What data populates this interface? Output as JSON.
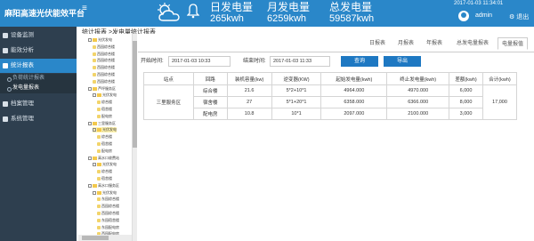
{
  "header": {
    "app_title": "麻阳高速光伏能效平台",
    "menu_icon": "hamburger-icon",
    "stats": [
      {
        "label": "日发电量",
        "value": "265kwh"
      },
      {
        "label": "月发电量",
        "value": "6259kwh"
      },
      {
        "label": "总发电量",
        "value": "59587kwh"
      }
    ],
    "datetime": "2017-01-03 11:34:01",
    "user": "admin",
    "logout": "退出"
  },
  "sidebar": {
    "items": [
      {
        "label": "设备监测",
        "icon": "monitor-icon"
      },
      {
        "label": "能效分析",
        "icon": "analysis-icon"
      },
      {
        "label": "统计报表",
        "icon": "report-icon"
      },
      {
        "label": "档案管理",
        "icon": "archive-icon"
      },
      {
        "label": "系统管理",
        "icon": "settings-icon"
      }
    ],
    "sub_items": [
      {
        "label": "负荷统计报表"
      },
      {
        "label": "发电量报表"
      }
    ]
  },
  "breadcrumb": "统计报表 >发电量统计报表",
  "tree": [
    {
      "label": "光伏发电",
      "level": 1,
      "type": "folder"
    },
    {
      "label": "西园综合楼",
      "level": 2,
      "type": "leaf"
    },
    {
      "label": "西园综合楼",
      "level": 2,
      "type": "leaf"
    },
    {
      "label": "西园综合楼",
      "level": 2,
      "type": "leaf"
    },
    {
      "label": "西园综合楼",
      "level": 2,
      "type": "leaf"
    },
    {
      "label": "西园综合楼",
      "level": 2,
      "type": "leaf"
    },
    {
      "label": "西园综合楼",
      "level": 2,
      "type": "leaf"
    },
    {
      "label": "芦坪服务区",
      "level": 1,
      "type": "folder"
    },
    {
      "label": "光伏发电",
      "level": 2,
      "type": "folder"
    },
    {
      "label": "综合楼",
      "level": 3,
      "type": "leaf"
    },
    {
      "label": "宿舍楼",
      "level": 3,
      "type": "leaf"
    },
    {
      "label": "配电房",
      "level": 3,
      "type": "leaf"
    },
    {
      "label": "三里服务区",
      "level": 1,
      "type": "folder"
    },
    {
      "label": "光伏发电",
      "level": 2,
      "type": "folder"
    },
    {
      "label": "综合楼",
      "level": 3,
      "type": "leaf"
    },
    {
      "label": "宿舍楼",
      "level": 3,
      "type": "leaf"
    },
    {
      "label": "配电房",
      "level": 3,
      "type": "leaf"
    },
    {
      "label": "高水口收费站",
      "level": 1,
      "type": "folder"
    },
    {
      "label": "光伏发电",
      "level": 2,
      "type": "folder"
    },
    {
      "label": "综合楼",
      "level": 3,
      "type": "leaf"
    },
    {
      "label": "宿舍楼",
      "level": 3,
      "type": "leaf"
    },
    {
      "label": "高水口服务区",
      "level": 1,
      "type": "folder"
    },
    {
      "label": "光伏发电",
      "level": 2,
      "type": "folder"
    },
    {
      "label": "东园综合楼",
      "level": 3,
      "type": "leaf"
    },
    {
      "label": "西园综合楼",
      "level": 3,
      "type": "leaf"
    },
    {
      "label": "西园综合楼",
      "level": 3,
      "type": "leaf"
    },
    {
      "label": "东园宿舍楼",
      "level": 3,
      "type": "leaf"
    },
    {
      "label": "东园配电房",
      "level": 3,
      "type": "leaf"
    },
    {
      "label": "西园配电房",
      "level": 3,
      "type": "leaf"
    }
  ],
  "tabs": [
    "日报表",
    "月报表",
    "年报表",
    "总发电量报表",
    "电量报值"
  ],
  "filter": {
    "start_label": "开始时间:",
    "start_value": "2017-01-03 10:33",
    "end_label": "结束时间:",
    "end_value": "2017-01-03 11:33",
    "query_button": "查询",
    "export_button": "导出"
  },
  "table": {
    "headers": [
      "站点",
      "回路",
      "装机容量(kw)",
      "逆变器(KW)",
      "起始发电量(kwh)",
      "终止发电量(kwh)",
      "差额(kwh)",
      "合计(kwh)"
    ],
    "station": "三里服务区",
    "total": "17,000",
    "rows": [
      {
        "loop": "综合楼",
        "capacity": "21.6",
        "inverter": "5*2+10*1",
        "start": "4964.000",
        "end": "4970.000",
        "diff": "6,000"
      },
      {
        "loop": "宿舍楼",
        "capacity": "27",
        "inverter": "5*1+20*1",
        "start": "6358.000",
        "end": "6366.000",
        "diff": "8,000"
      },
      {
        "loop": "配电房",
        "capacity": "10.8",
        "inverter": "10*1",
        "start": "2097.000",
        "end": "2100.000",
        "diff": "3,000"
      }
    ]
  },
  "colors": {
    "header": "#2a87c9",
    "sidebar": "#2e3f4f",
    "button": "#1e78c2"
  }
}
